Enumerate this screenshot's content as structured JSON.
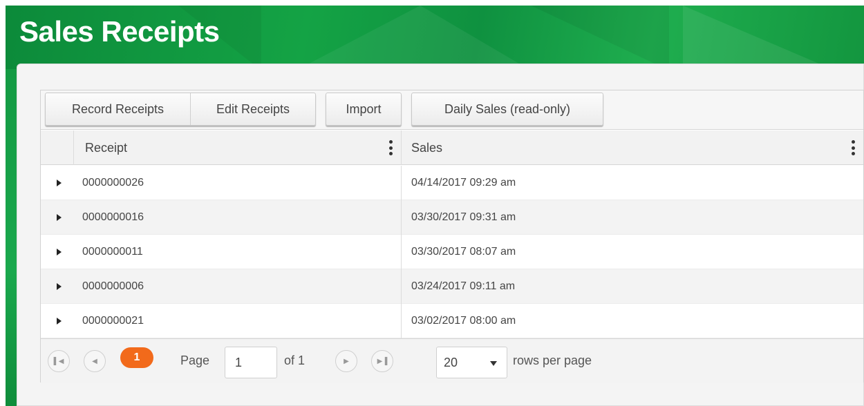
{
  "page": {
    "title": "Sales Receipts"
  },
  "toolbar": {
    "record_receipts": "Record Receipts",
    "edit_receipts": "Edit Receipts",
    "import": "Import",
    "daily_sales": "Daily Sales (read-only)"
  },
  "table": {
    "columns": [
      "Receipt",
      "Sales"
    ],
    "rows": [
      {
        "receipt": "0000000026",
        "sales": "04/14/2017 09:29 am"
      },
      {
        "receipt": "0000000016",
        "sales": "03/30/2017 09:31 am"
      },
      {
        "receipt": "0000000011",
        "sales": "03/30/2017 08:07 am"
      },
      {
        "receipt": "0000000006",
        "sales": "03/24/2017 09:11 am"
      },
      {
        "receipt": "0000000021",
        "sales": "03/02/2017 08:00 am"
      }
    ]
  },
  "pager": {
    "current_page": "1",
    "page_label": "Page",
    "page_input_value": "1",
    "of_label": "of 1",
    "rows_per_page_value": "20",
    "rows_per_page_label": "rows per page"
  },
  "colors": {
    "banner": "#14a345",
    "current_page": "#f26a1b"
  }
}
